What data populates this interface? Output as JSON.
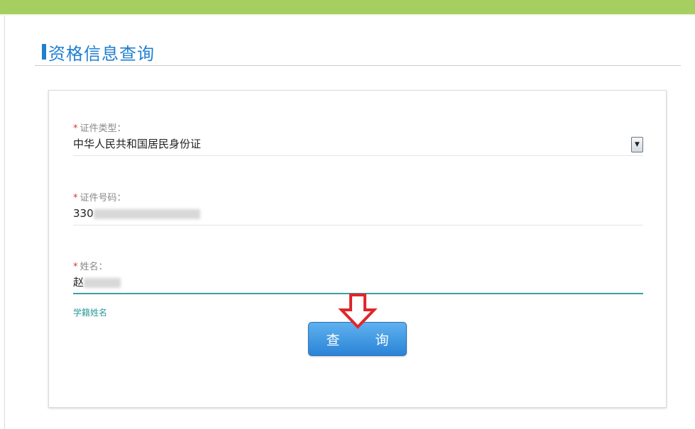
{
  "page": {
    "title": "资格信息查询",
    "accent_color": "#1f7fd0",
    "top_bar_color": "#a6cf62"
  },
  "form": {
    "cert_type": {
      "required_mark": "*",
      "label": "证件类型：",
      "value": "中华人民共和国居民身份证",
      "dropdown_icon": "chevron-down-icon"
    },
    "cert_number": {
      "required_mark": "*",
      "label": "证件号码：",
      "value": "330"
    },
    "name": {
      "required_mark": "*",
      "label": "姓名：",
      "value": "赵"
    },
    "hint": "学籍姓名",
    "query_button_label": "查 询"
  },
  "annotation": {
    "arrow_icon": "down-arrow-icon",
    "arrow_color": "#e0262a"
  }
}
